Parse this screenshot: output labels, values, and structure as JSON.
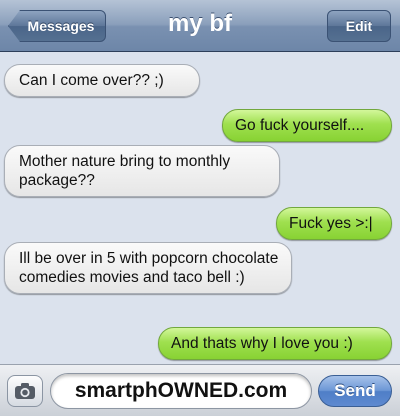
{
  "navbar": {
    "back_label": "Messages",
    "title": "my bf",
    "edit_label": "Edit"
  },
  "messages": [
    {
      "direction": "received",
      "text": "Can I come over?? ;)"
    },
    {
      "direction": "sent",
      "text": "Go fuck yourself...."
    },
    {
      "direction": "received",
      "text": "Mother nature bring to monthly package??"
    },
    {
      "direction": "sent",
      "text": "Fuck yes >:|"
    },
    {
      "direction": "received",
      "text": "Ill be over in 5 with popcorn chocolate comedies movies and taco bell :)"
    },
    {
      "direction": "sent",
      "text": "And thats why I love you :)"
    }
  ],
  "input": {
    "camera_icon": "camera-icon",
    "field_value": "smartphOWNED.com",
    "send_label": "Send"
  },
  "colors": {
    "sent_bubble": "#9fe04f",
    "received_bubble": "#eeeeee",
    "navbar": "#7a91b1",
    "send_button": "#5e8ad0"
  }
}
